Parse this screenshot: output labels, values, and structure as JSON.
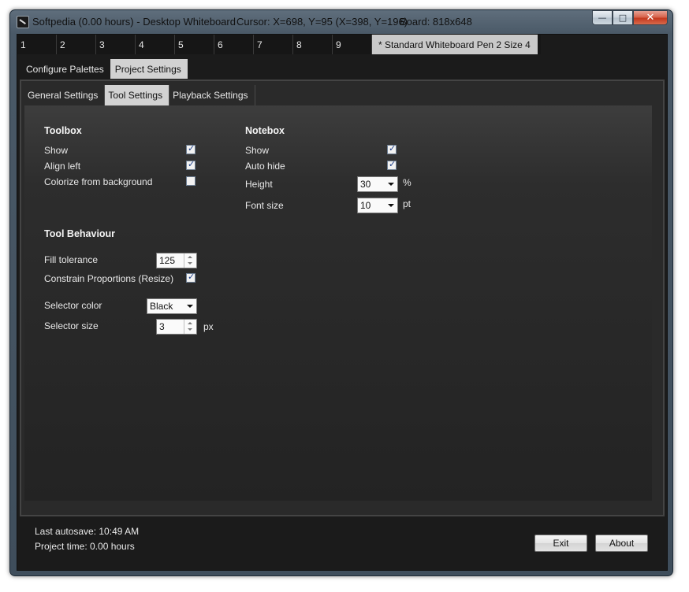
{
  "window": {
    "title_app": "Softpedia (0.00 hours) - Desktop Whiteboard",
    "title_cursor": "Cursor: X=698, Y=95 (X=398, Y=196)",
    "title_board": "Board: 818x648",
    "controls": {
      "minimize": "—",
      "maximize": "□",
      "close": "✕"
    }
  },
  "board_tabs": [
    "1",
    "2",
    "3",
    "4",
    "5",
    "6",
    "7",
    "8",
    "9"
  ],
  "current_board": "* Standard Whiteboard   Pen 2   Size 4",
  "main_tabs": [
    {
      "label": "Configure Palettes"
    },
    {
      "label": "Project Settings"
    }
  ],
  "sub_tabs": [
    {
      "label": "General Settings"
    },
    {
      "label": "Tool Settings"
    },
    {
      "label": "Playback Settings"
    }
  ],
  "toolbox": {
    "heading": "Toolbox",
    "show_label": "Show",
    "show_checked": true,
    "align_left_label": "Align left",
    "align_left_checked": true,
    "colorize_label": "Colorize from background",
    "colorize_checked": false
  },
  "notebox": {
    "heading": "Notebox",
    "show_label": "Show",
    "show_checked": true,
    "auto_hide_label": "Auto hide",
    "auto_hide_checked": true,
    "height_label": "Height",
    "height_value": "30",
    "height_unit": "%",
    "font_size_label": "Font size",
    "font_size_value": "10",
    "font_size_unit": "pt"
  },
  "tool_behaviour": {
    "heading": "Tool Behaviour",
    "fill_tolerance_label": "Fill tolerance",
    "fill_tolerance_value": "125",
    "constrain_label": "Constrain Proportions (Resize)",
    "constrain_checked": true,
    "selector_color_label": "Selector color",
    "selector_color_value": "Black",
    "selector_size_label": "Selector size",
    "selector_size_value": "3",
    "selector_size_unit": "px"
  },
  "status": {
    "last_autosave": "Last autosave: 10:49 AM",
    "project_time": "Project time: 0.00 hours"
  },
  "buttons": {
    "exit": "Exit",
    "about": "About"
  }
}
